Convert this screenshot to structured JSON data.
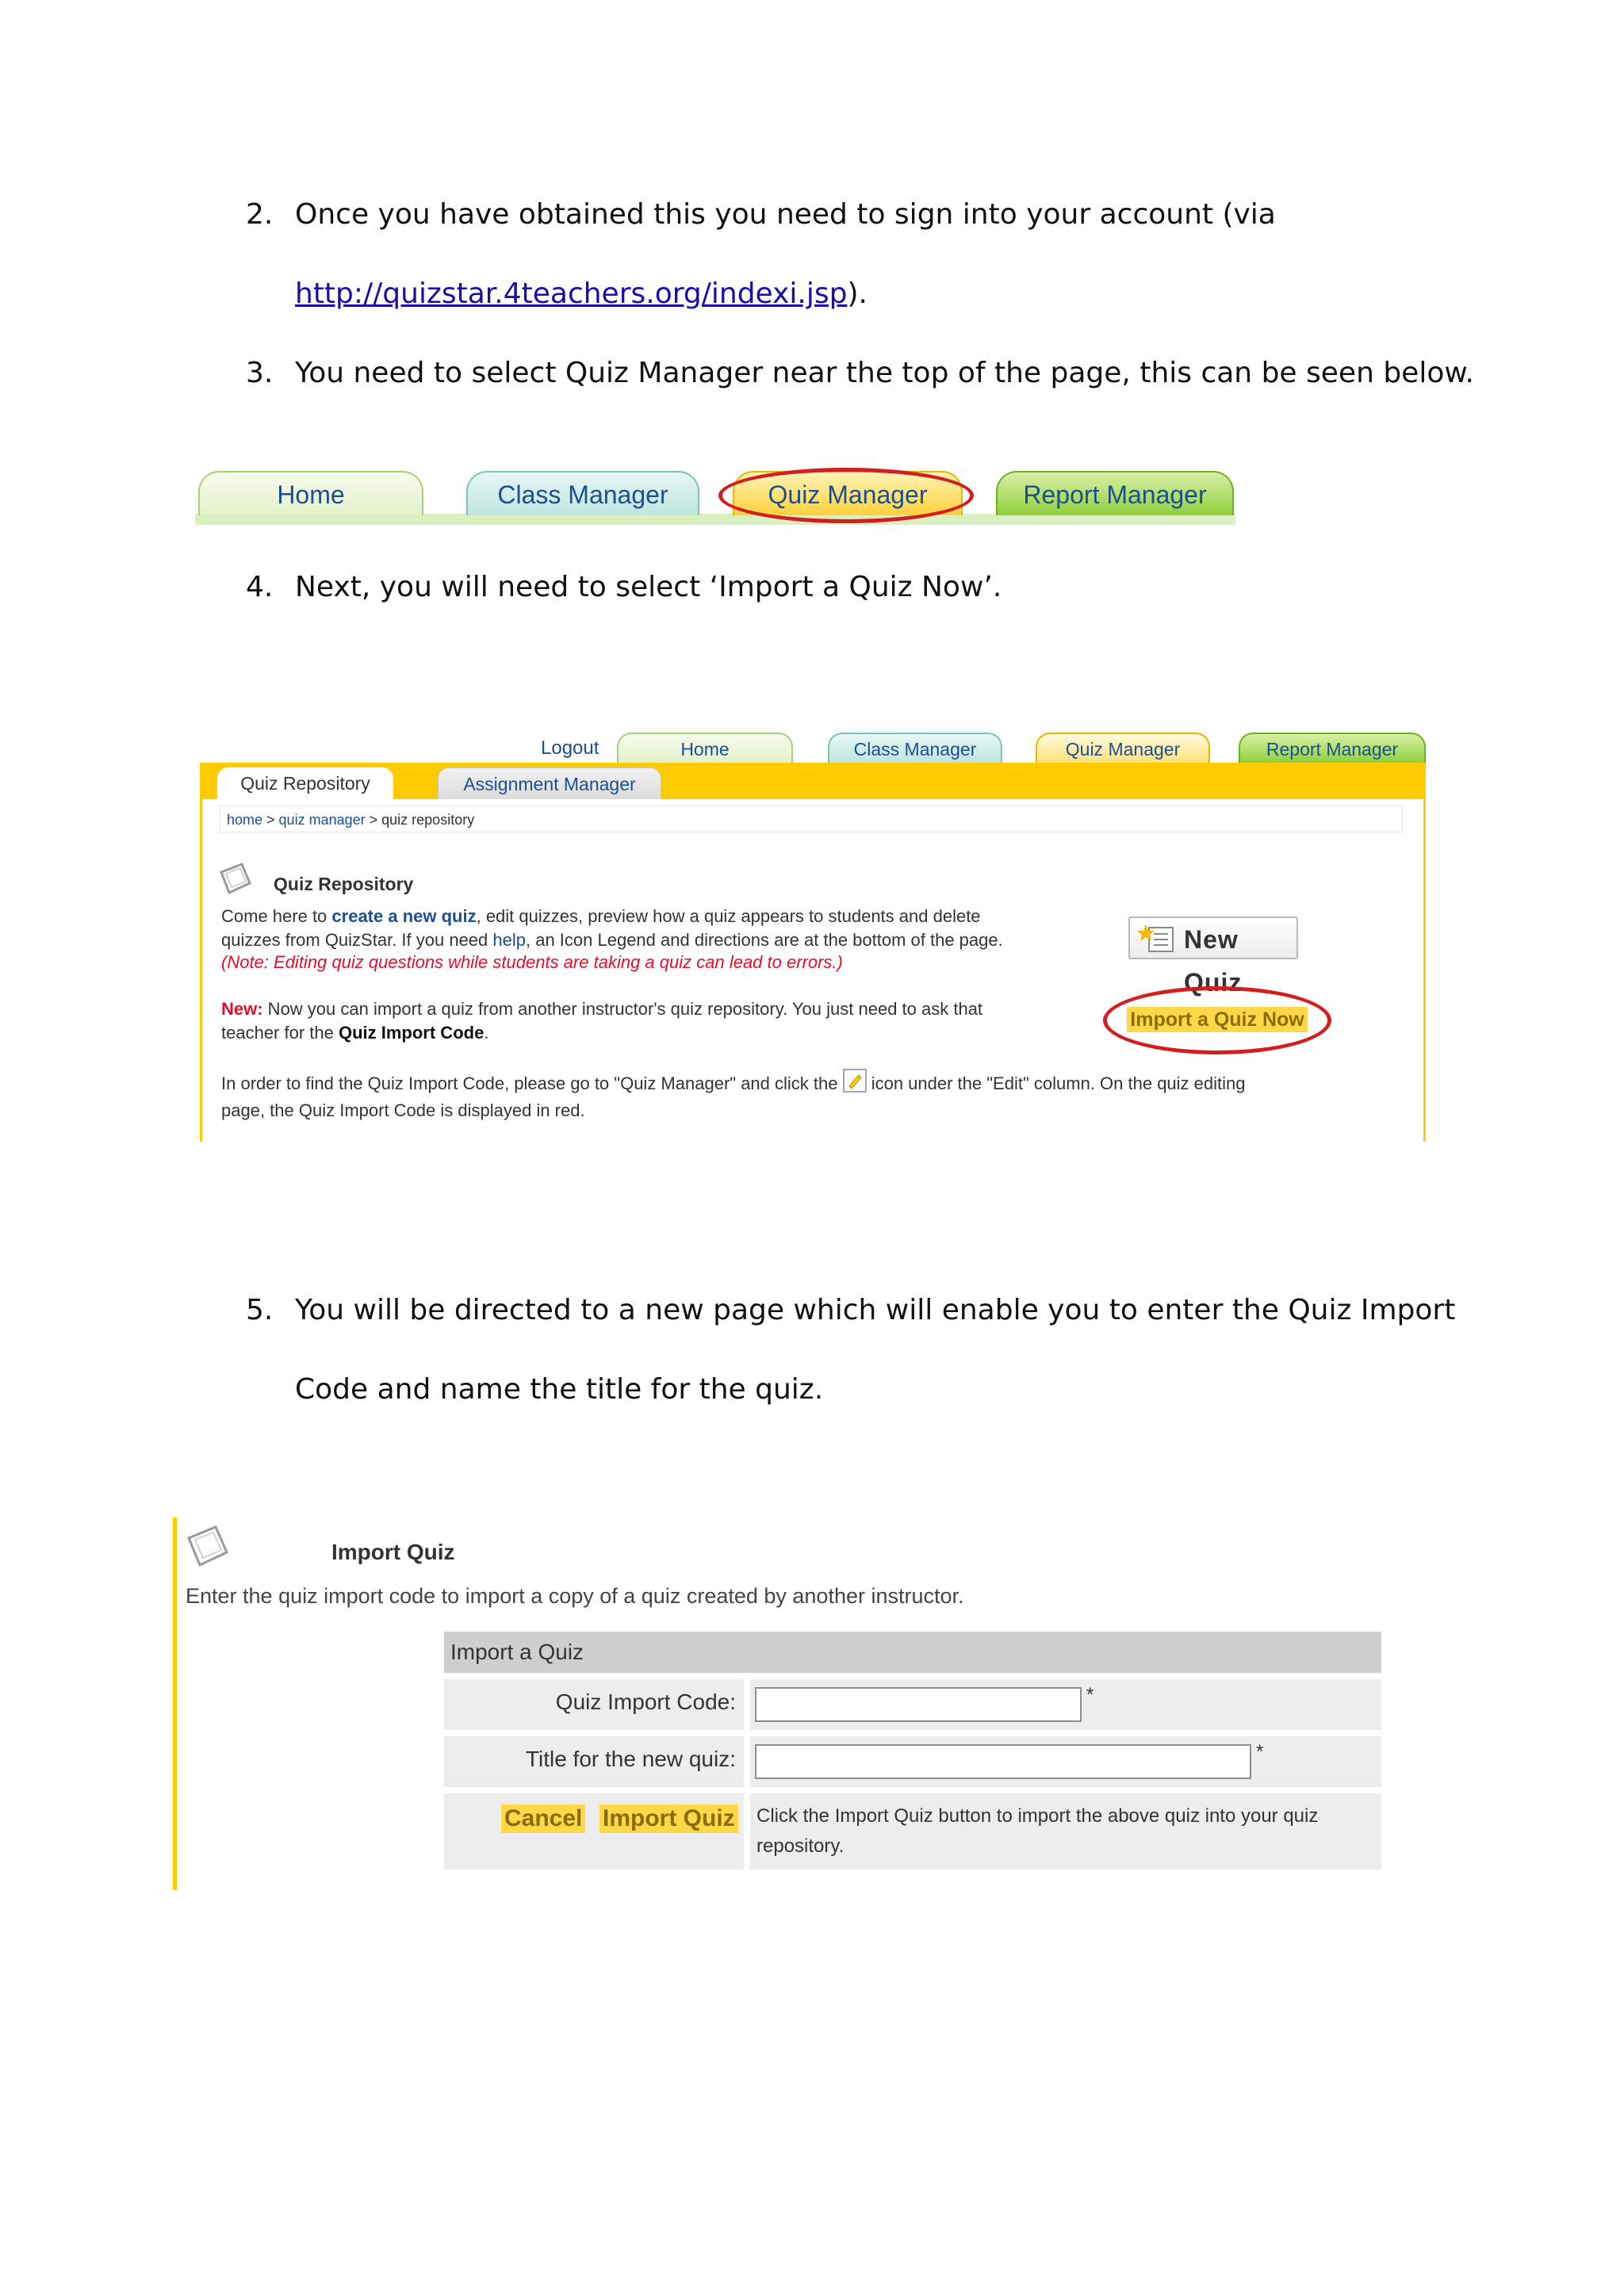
{
  "steps": {
    "s2": {
      "num": "2.",
      "line1": "Once you have obtained this you need to sign into your account (via",
      "link": "http://quizstar.4teachers.org/indexi.jsp",
      "after_link": ")."
    },
    "s3": {
      "num": "3.",
      "text": "You need to select Quiz Manager near the top of the page, this can be seen below."
    },
    "s4": {
      "num": "4.",
      "text": "Next, you will need to select ‘Import a Quiz Now’."
    },
    "s5": {
      "num": "5.",
      "line1": "You will be directed to a new page which will enable you to enter the Quiz Import",
      "line2": "Code and name the title for the quiz."
    }
  },
  "fig1": {
    "tabs": {
      "home": "Home",
      "class": "Class Manager",
      "quiz": "Quiz Manager",
      "report": "Report Manager"
    },
    "highlight_color": "#d21e1e"
  },
  "fig2": {
    "logout": "Logout",
    "tabs": {
      "home": "Home",
      "class": "Class Manager",
      "quiz": "Quiz Manager",
      "report": "Report Manager"
    },
    "subtabs": {
      "repo": "Quiz Repository",
      "assign": "Assignment Manager"
    },
    "breadcrumb": {
      "home": "home",
      "sep1": " > ",
      "quiz_manager": "quiz manager",
      "sep2": " > ",
      "current": "quiz repository"
    },
    "heading": "Quiz Repository",
    "para1": {
      "a": "Come here to ",
      "create": "create a new quiz",
      "b": ", edit quizzes, preview how a quiz appears to students and delete",
      "c": "quizzes from QuizStar. If you need ",
      "help": "help",
      "d": ", an Icon Legend and directions are at the bottom of the page.",
      "note": "(Note: Editing quiz questions while students are taking a quiz can lead to errors.)"
    },
    "para2": {
      "new_label": "New:",
      "a": " Now you can import a quiz from another instructor's quiz repository. You just need to ask that",
      "b": "teacher for the ",
      "code": "Quiz Import Code",
      "c": "."
    },
    "para3": {
      "a": "In order to find the Quiz Import Code, please go to \"Quiz Manager\" and click the ",
      "b": " icon under the \"Edit\" column. On the quiz editing",
      "c": "page, the Quiz Import Code is displayed in red."
    },
    "new_quiz_button": "New Quiz",
    "import_button": "Import a Quiz Now",
    "accent_color": "#ffcc00"
  },
  "fig3": {
    "title": "Import Quiz",
    "description": "Enter the quiz import code to import a copy of a quiz created by another instructor.",
    "table_header": "Import a Quiz",
    "code_label": "Quiz Import Code:",
    "code_value": "",
    "title_label": "Title for the new quiz:",
    "title_value": "",
    "required_mark": "*",
    "cancel_button": "Cancel",
    "import_button": "Import Quiz",
    "note_line1": "Click the Import Quiz button to import the above quiz into your quiz",
    "note_line2": "repository."
  }
}
